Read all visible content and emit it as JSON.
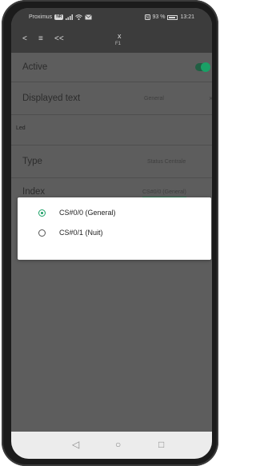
{
  "status_bar": {
    "carrier": "Proximus",
    "carrier_badge": "NR",
    "battery_text": "93 %",
    "time": "13:21"
  },
  "app_bar": {
    "back_icon": "chevron-left-icon",
    "menu_icon": "menu-icon",
    "double_back_icon": "double-chevron-left-icon",
    "close_symbol": "x",
    "title": "F1"
  },
  "form": {
    "active": {
      "label": "Active",
      "toggle_on": true
    },
    "displayed_text": {
      "label": "Displayed text",
      "value": "General"
    },
    "section_header": "Led",
    "type": {
      "label": "Type",
      "value": "Status Centrale"
    },
    "index": {
      "label": "Index",
      "value": "CS#0/0 (General)"
    }
  },
  "dialog": {
    "options": [
      {
        "label": "CS#0/0 (General)",
        "selected": true
      },
      {
        "label": "CS#0/1 (Nuit)",
        "selected": false
      }
    ]
  },
  "colors": {
    "accent": "#1aa066",
    "overlay": "#5d5d5d",
    "bar": "#3c3c3c"
  },
  "nav_bar": {
    "back": "◁",
    "home": "○",
    "recents": "□"
  }
}
